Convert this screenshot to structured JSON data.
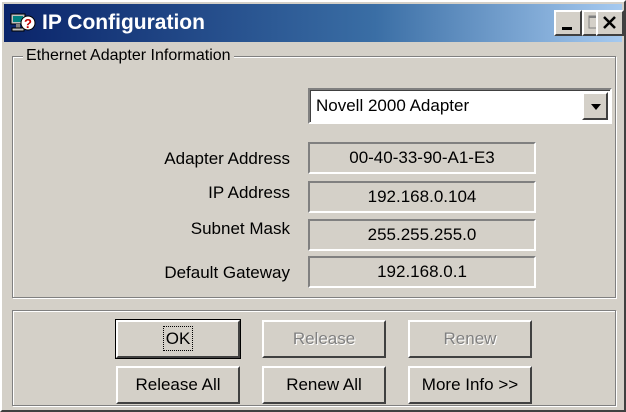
{
  "window": {
    "title": "IP Configuration"
  },
  "title_buttons": {
    "minimize_icon": "minimize-icon",
    "maximize_icon": "maximize-icon",
    "close_icon": "close-icon"
  },
  "group": {
    "label": "Ethernet  Adapter Information"
  },
  "adapter_select": {
    "selected": "Novell 2000 Adapter",
    "icon": "chevron-down-icon"
  },
  "rows": [
    {
      "label": "Adapter Address",
      "value": "00-40-33-90-A1-E3"
    },
    {
      "label": "IP Address",
      "value": "192.168.0.104"
    },
    {
      "label": "Subnet Mask",
      "value": "255.255.255.0"
    },
    {
      "label": "Default Gateway",
      "value": "192.168.0.1"
    }
  ],
  "buttons": {
    "ok": "OK",
    "release": "Release",
    "renew": "Renew",
    "release_all": "Release All",
    "renew_all": "Renew All",
    "more_info": "More Info >>"
  }
}
